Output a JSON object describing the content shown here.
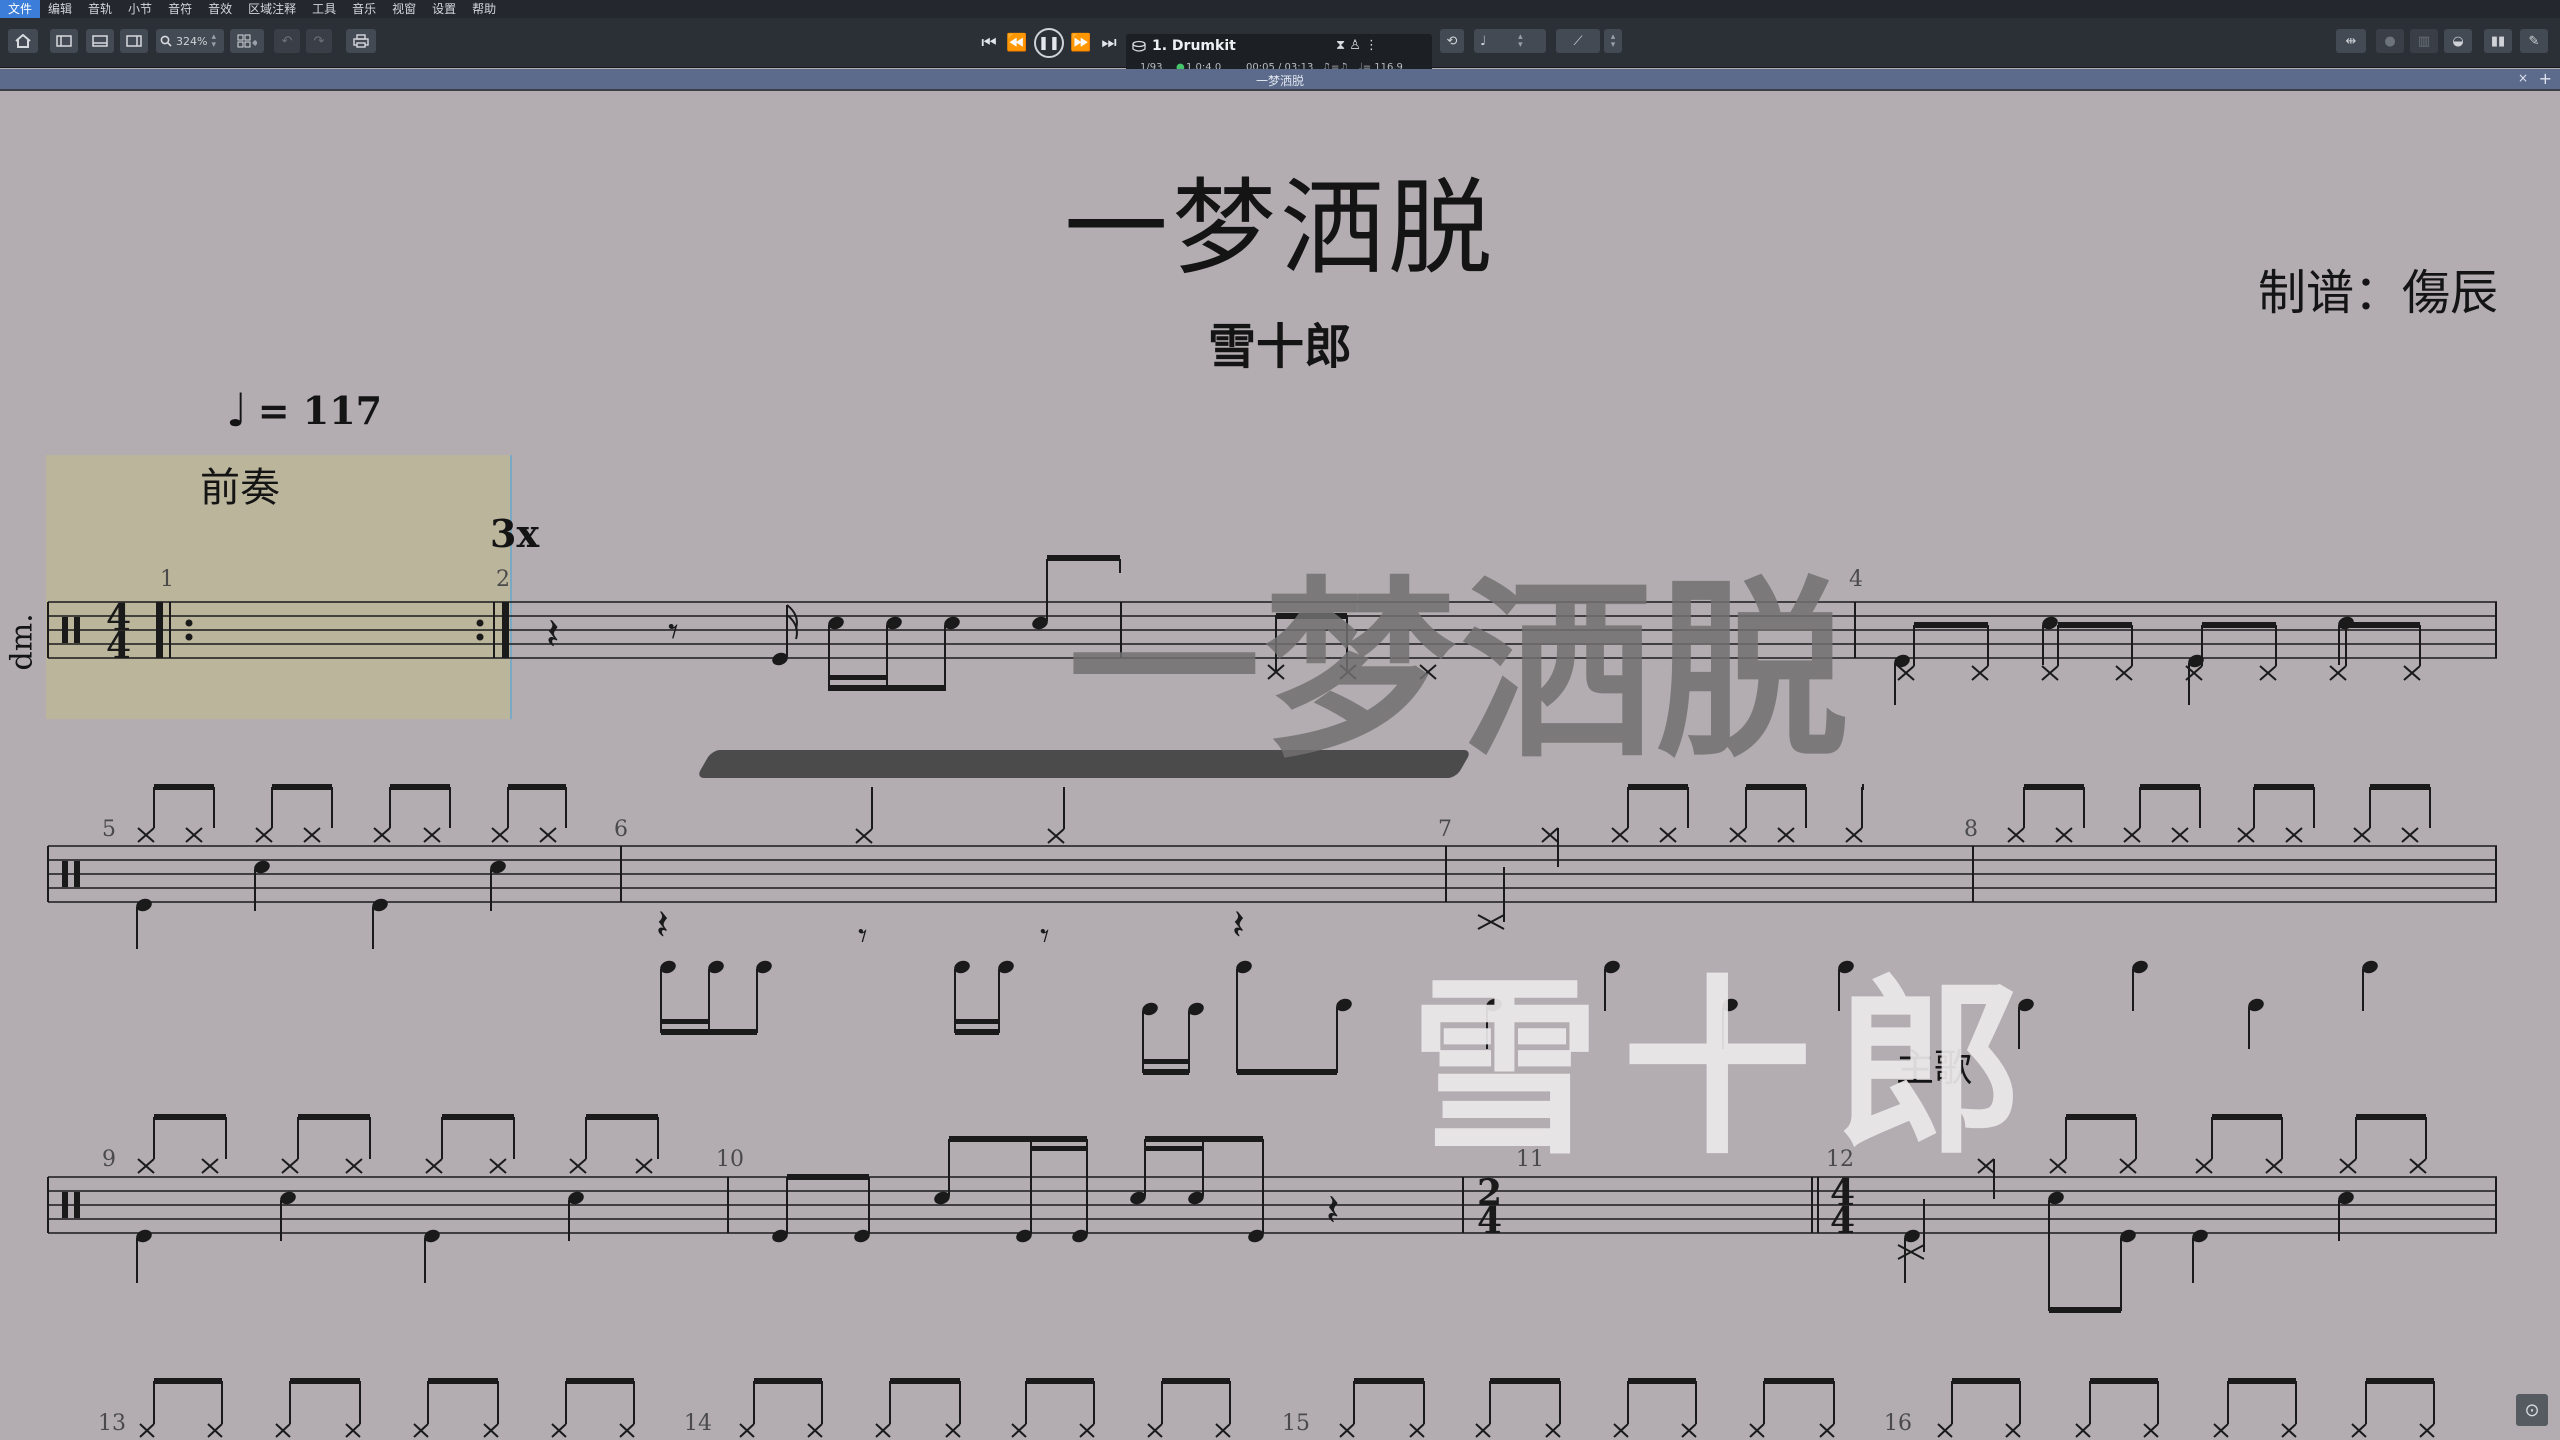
{
  "menu": [
    "文件",
    "编辑",
    "音轨",
    "小节",
    "音符",
    "音效",
    "区域注释",
    "工具",
    "音乐",
    "视窗",
    "设置",
    "帮助"
  ],
  "toolbar": {
    "zoom": "324%",
    "track_name": "1. Drumkit",
    "bar_position": "1/93",
    "beat_position": "1.0:4.0",
    "time": "00:05 / 03:13",
    "tempo_readout": "♩= 116.9"
  },
  "tab": {
    "title": "一梦洒脱"
  },
  "score": {
    "title": "一梦洒脱",
    "subtitle": "雪十郎",
    "arranger": "制谱：傷辰",
    "tempo_value": "= 117",
    "section_label": "前奏",
    "repeat_count": "3x",
    "instrument": "dm.",
    "marker": "主歌",
    "measure_numbers": [
      "1",
      "2",
      "4",
      "5",
      "6",
      "7",
      "8",
      "9",
      "10",
      "11",
      "12",
      "13",
      "14",
      "15",
      "16"
    ],
    "time_signatures": [
      "4/4",
      "2/4",
      "4/4"
    ]
  },
  "watermark": {
    "title": "一梦洒脱",
    "artist": "雪十郎"
  },
  "icons": {
    "home": "home-icon",
    "print": "print-icon",
    "play": "play-icon",
    "prev": "skip-back-icon",
    "rewind": "rewind-icon",
    "forward": "fast-forward-icon",
    "next": "skip-forward-icon",
    "metronome": "metronome-icon",
    "loop": "loop-icon"
  }
}
